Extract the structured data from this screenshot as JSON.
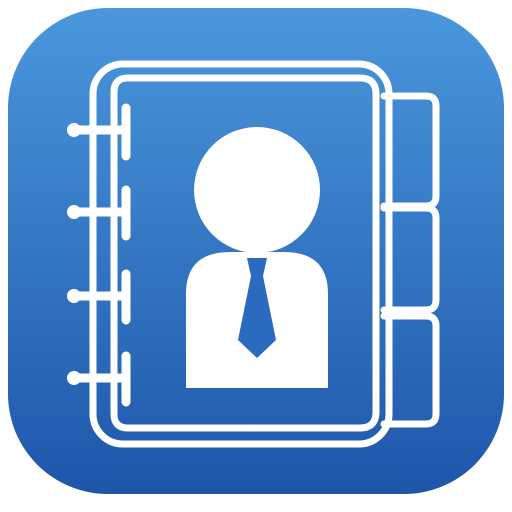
{
  "app_icon": {
    "icon": "address-book-icon",
    "subject": "person-with-tie-icon",
    "colors": {
      "gradient_top": "#4a97dc",
      "gradient_bottom": "#1e56aa",
      "foreground": "#ffffff",
      "tie": "#2a6bbf"
    }
  }
}
